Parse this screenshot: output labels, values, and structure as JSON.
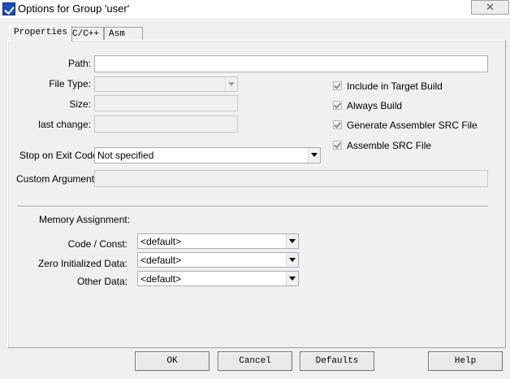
{
  "window": {
    "title": "Options for Group 'user'",
    "close_glyph": "✕"
  },
  "tabs": [
    {
      "label": "Properties",
      "active": true
    },
    {
      "label": "C/C++",
      "active": false
    },
    {
      "label": "Asm",
      "active": false
    }
  ],
  "properties": {
    "path_label": "Path:",
    "path_value": "",
    "file_type_label": "File Type:",
    "file_type_value": "",
    "size_label": "Size:",
    "size_value": "",
    "last_change_label": "last change:",
    "last_change_value": "",
    "stop_on_exit_label": "Stop on Exit Code:",
    "stop_on_exit_value": "Not specified",
    "custom_args_label": "Custom Arguments:",
    "custom_args_value": ""
  },
  "options": [
    {
      "label": "Include in Target Build",
      "checked": true
    },
    {
      "label": "Always Build",
      "checked": true
    },
    {
      "label": "Generate Assembler SRC File",
      "checked": true
    },
    {
      "label": "Assemble SRC File",
      "checked": true
    }
  ],
  "memory": {
    "heading": "Memory Assignment:",
    "code_const_label": "Code / Const:",
    "code_const_value": "<default>",
    "zero_init_label": "Zero Initialized Data:",
    "zero_init_value": "<default>",
    "other_data_label": "Other Data:",
    "other_data_value": "<default>"
  },
  "buttons": {
    "ok": "OK",
    "cancel": "Cancel",
    "defaults": "Defaults",
    "help": "Help"
  },
  "colors": {
    "dialog_bg": "#f0f0f0",
    "title_icon": "#1b4fb8",
    "field_border": "#abadb3"
  }
}
